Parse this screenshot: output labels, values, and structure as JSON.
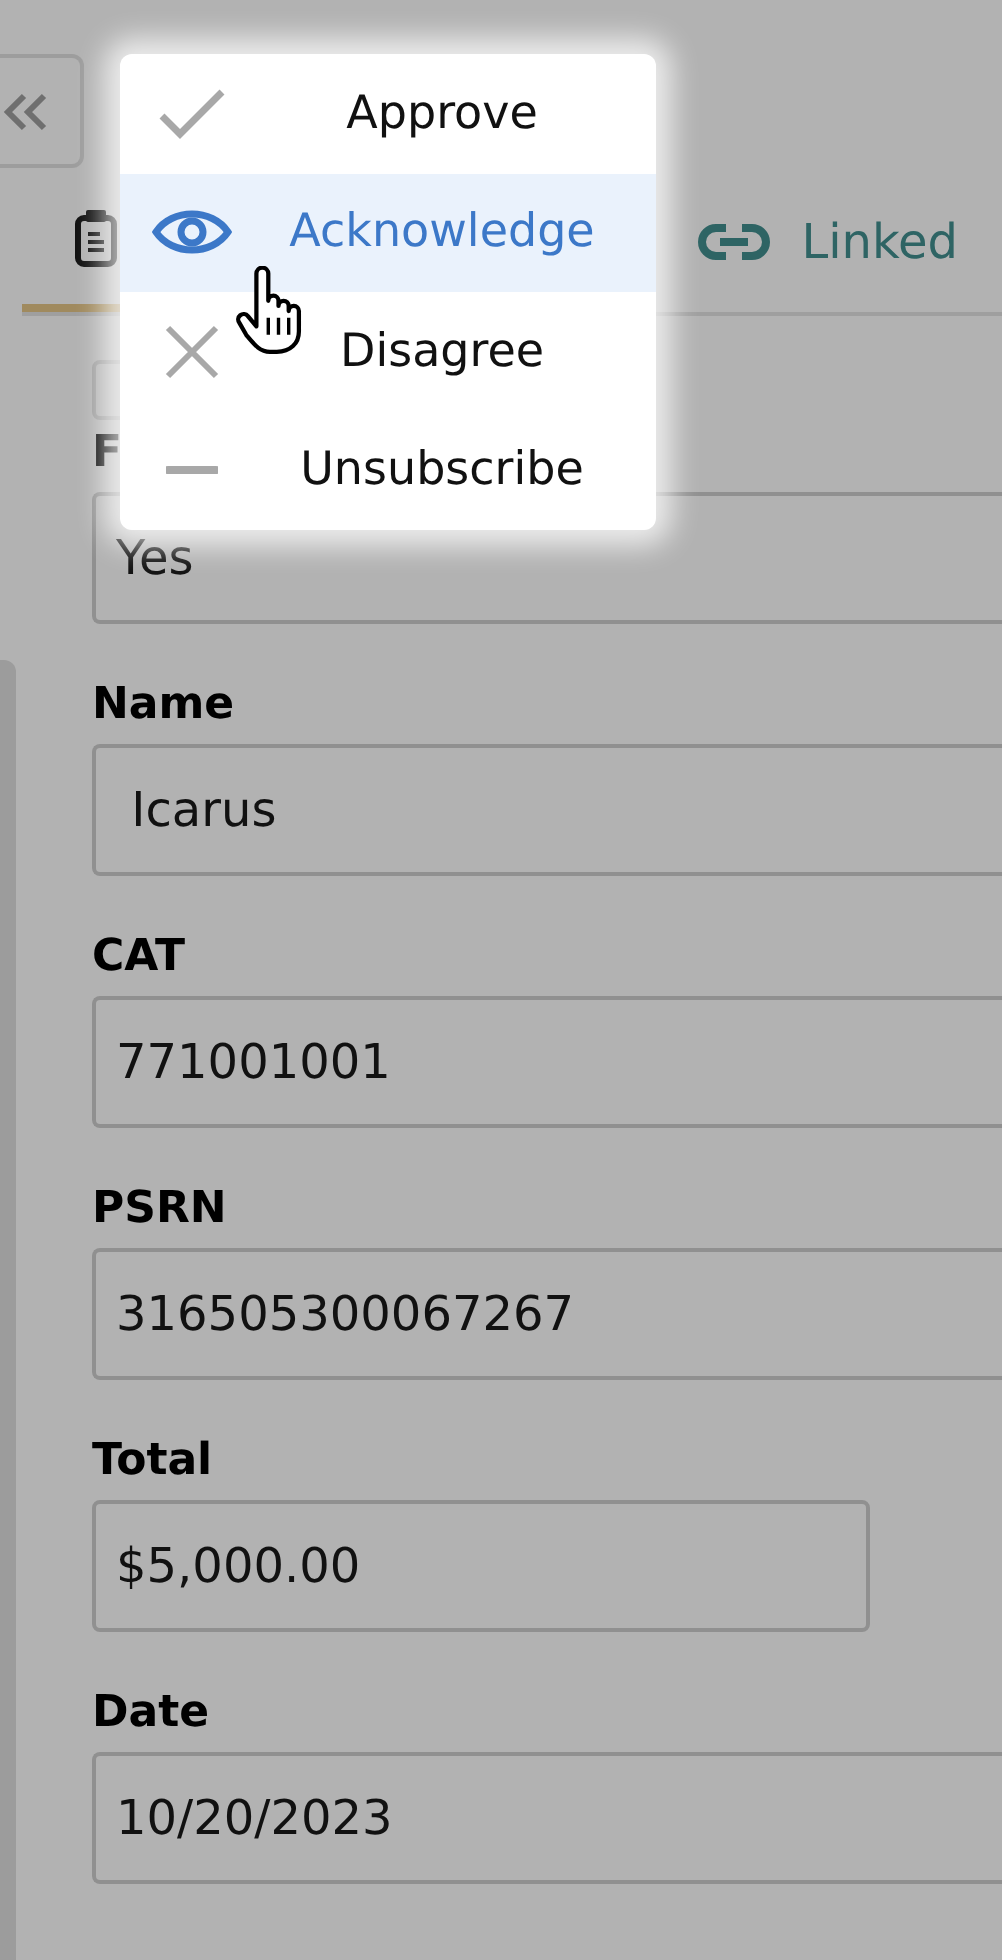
{
  "tabs": [
    {
      "selected": true
    },
    {
      "label": "Linked",
      "selected": false
    }
  ],
  "menu": [
    {
      "label": "Approve",
      "selected": false
    },
    {
      "label": "Acknowledge",
      "selected": true
    },
    {
      "label": "Disagree",
      "selected": false
    },
    {
      "label": "Unsubscribe",
      "selected": false
    }
  ],
  "checkbox": {
    "checked": false
  },
  "fields": [
    {
      "label": "F",
      "value": "Yes",
      "wide": true
    },
    {
      "label": "Name",
      "value": " Icarus",
      "wide": true
    },
    {
      "label": "CAT",
      "value": "771001001",
      "wide": true
    },
    {
      "label": "PSRN",
      "value": "316505300067267",
      "wide": true
    },
    {
      "label": "Total",
      "value": "$5,000.00",
      "wide": false
    },
    {
      "label": "Date",
      "value": "10/20/2023",
      "wide": true
    }
  ]
}
